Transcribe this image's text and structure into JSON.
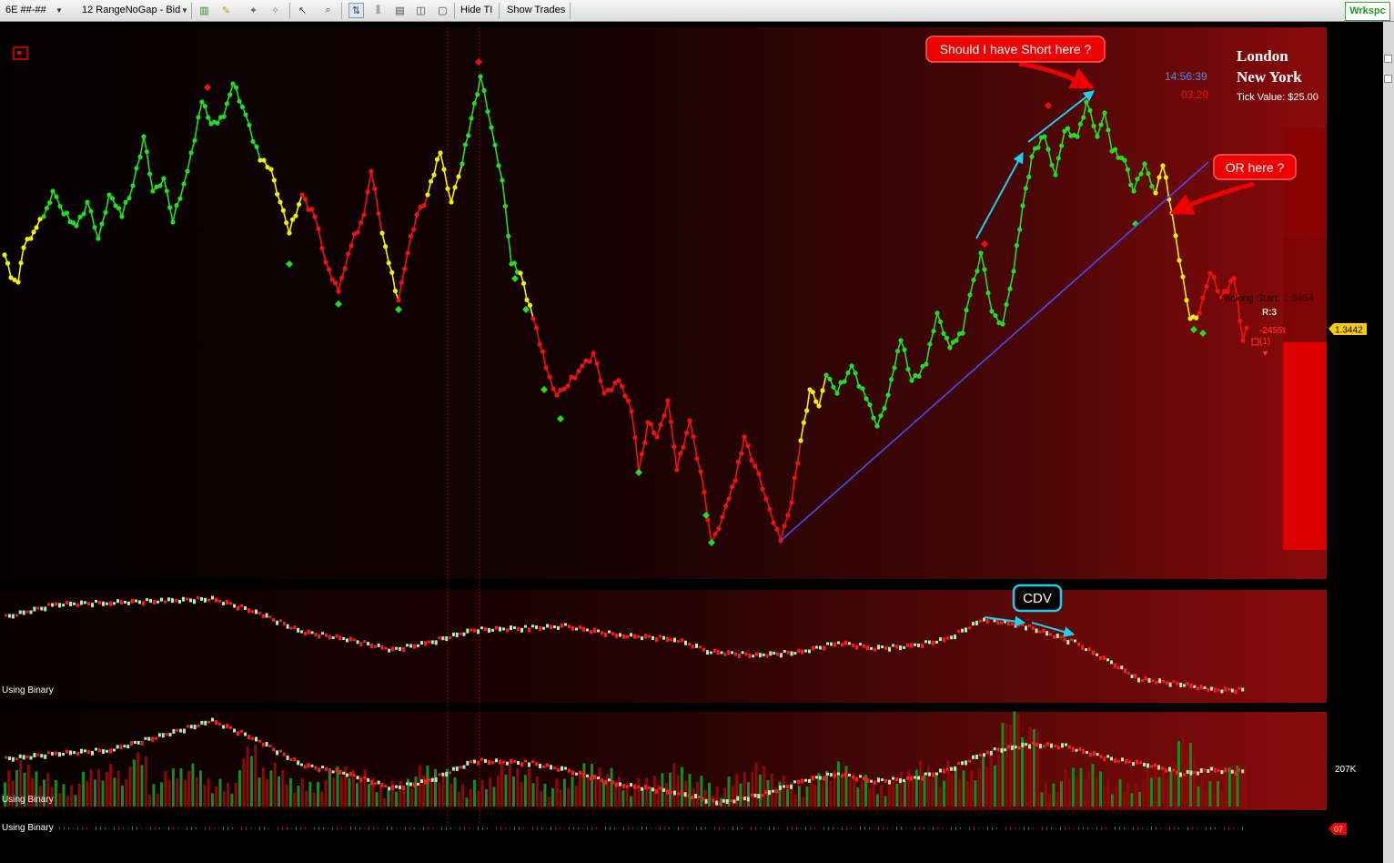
{
  "toolbar": {
    "instrument": "6E ##-##",
    "bar_type": "12 RangeNoGap - Bid",
    "hide_ti": "Hide TI",
    "show_trades": "Show Trades",
    "workspace": "Wrkspc"
  },
  "chart": {
    "session_line1": "London",
    "session_line2": "New York",
    "tick_value": "Tick Value: $25.00",
    "clock": "14:56:39",
    "countdown": "03:20",
    "price_marker": "1.3442",
    "tracking": "Tracking Start: 1.3454",
    "r_label": "R:3",
    "pnl": "-2455t",
    "position": "(1)",
    "callout_short": "Should I have Short here ?",
    "callout_or": "OR here ?",
    "callout_cdv": "CDV",
    "panel2_label": "Using Binary",
    "panel3_label": "Using Binary",
    "panel3_value": "207K",
    "panel4_label": "Using Binary",
    "panel4_value": "07"
  },
  "colors": {
    "up": "#22dd22",
    "neutral": "#f0f000",
    "down": "#ee1111",
    "trend_line": "#4a4af0",
    "arrow_cyan": "#22ccee",
    "callout_red": "#ee0000"
  },
  "chart_data": {
    "type": "line",
    "title": "6E ##-## 12 RangeNoGap - Bid",
    "y_unit": "price",
    "last_price": 1.3442,
    "tracking_start": 1.3454,
    "series_colors_by_state": [
      "green",
      "yellow",
      "red"
    ]
  }
}
